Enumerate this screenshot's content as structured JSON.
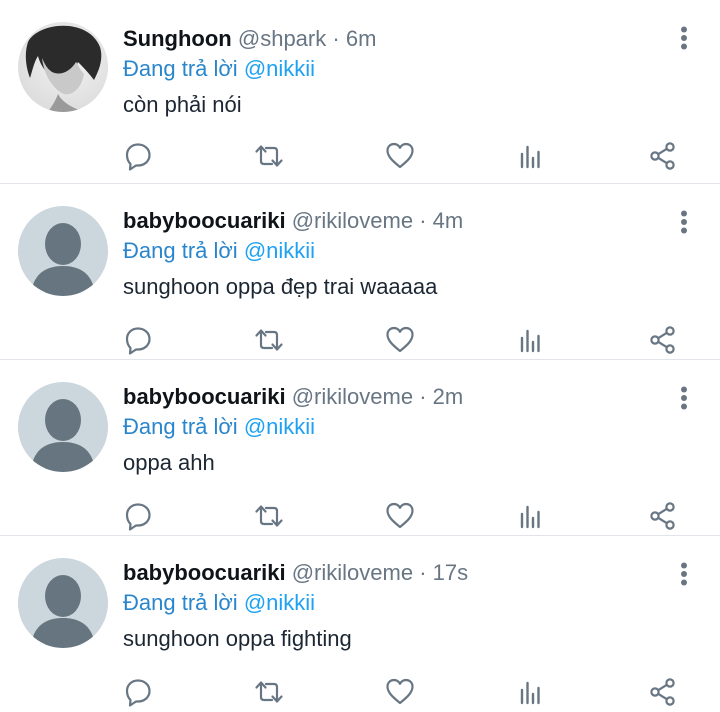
{
  "reply_prefix": "Đang trả lời",
  "colors": {
    "text": "#0f1419",
    "muted": "#687684",
    "link": "#1da1f2",
    "icon": "#687684",
    "divider": "#e1e4e8"
  },
  "icons": {
    "reply": "reply-icon",
    "retweet": "retweet-icon",
    "like": "heart-icon",
    "stats": "stats-icon",
    "share": "share-icon",
    "more": "more-vertical-icon"
  },
  "tweets": [
    {
      "name": "Sunghoon",
      "handle": "@shpark",
      "separator": "·",
      "time": "6m",
      "reply_to": "@nikkii",
      "text": "còn phải nói"
    },
    {
      "name": "babyboocuariki",
      "handle": "@rikiloveme",
      "separator": "·",
      "time": "4m",
      "reply_to": "@nikkii",
      "text": "sunghoon oppa đẹp trai waaaaa"
    },
    {
      "name": "babyboocuariki",
      "handle": "@rikiloveme",
      "separator": "·",
      "time": "2m",
      "reply_to": "@nikkii",
      "text": "oppa ahh"
    },
    {
      "name": "babyboocuariki",
      "handle": "@rikiloveme",
      "separator": "·",
      "time": "17s",
      "reply_to": "@nikkii",
      "text": "sunghoon oppa fighting"
    }
  ]
}
